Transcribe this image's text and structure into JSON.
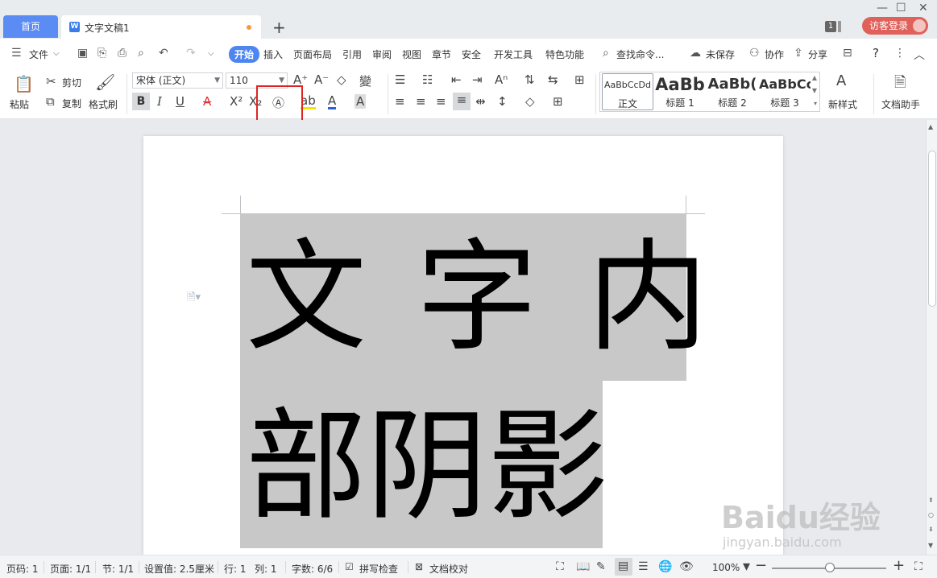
{
  "tabs": {
    "home": "首页",
    "doc_title": "文字文稿1",
    "add": "+"
  },
  "window": {
    "badge": "1",
    "login": "访客登录",
    "minimize": "—",
    "maximize": "☐",
    "close": "✕"
  },
  "menu": {
    "file": "文件",
    "items": [
      "开始",
      "插入",
      "页面布局",
      "引用",
      "审阅",
      "视图",
      "章节",
      "安全",
      "开发工具",
      "特色功能"
    ],
    "search": "查找命令...",
    "unsaved": "未保存",
    "collab": "协作",
    "share": "分享",
    "help": "?"
  },
  "ribbon": {
    "paste": "粘贴",
    "cut": "剪切",
    "copy": "复制",
    "format_painter": "格式刷",
    "font_name": "宋体 (正文)",
    "font_size": "110",
    "bold": "B",
    "italic": "I",
    "underline": "U",
    "styles": [
      {
        "preview": "AaBbCcDd",
        "label": "正文"
      },
      {
        "preview": "AaBb",
        "label": "标题 1"
      },
      {
        "preview": "AaBb(",
        "label": "标题 2"
      },
      {
        "preview": "AaBbCc",
        "label": "标题 3"
      }
    ],
    "new_style": "新样式",
    "doc_assistant": "文档助手"
  },
  "document": {
    "line1": "文字内",
    "line2": "部阴影"
  },
  "status": {
    "page_no": "页码: 1",
    "pages": "页面: 1/1",
    "section": "节: 1/1",
    "setting": "设置值: 2.5厘米",
    "row": "行: 1",
    "col": "列: 1",
    "word_count": "字数: 6/6",
    "spell_check": "拼写检查",
    "proofread": "文档校对",
    "zoom": "100%"
  },
  "watermark": {
    "brand": "Baidu经验",
    "url": "jingyan.baidu.com"
  },
  "colors": {
    "accent": "#4d86f0",
    "selection": "#c8c8c8",
    "highlight_box": "#e02424"
  }
}
